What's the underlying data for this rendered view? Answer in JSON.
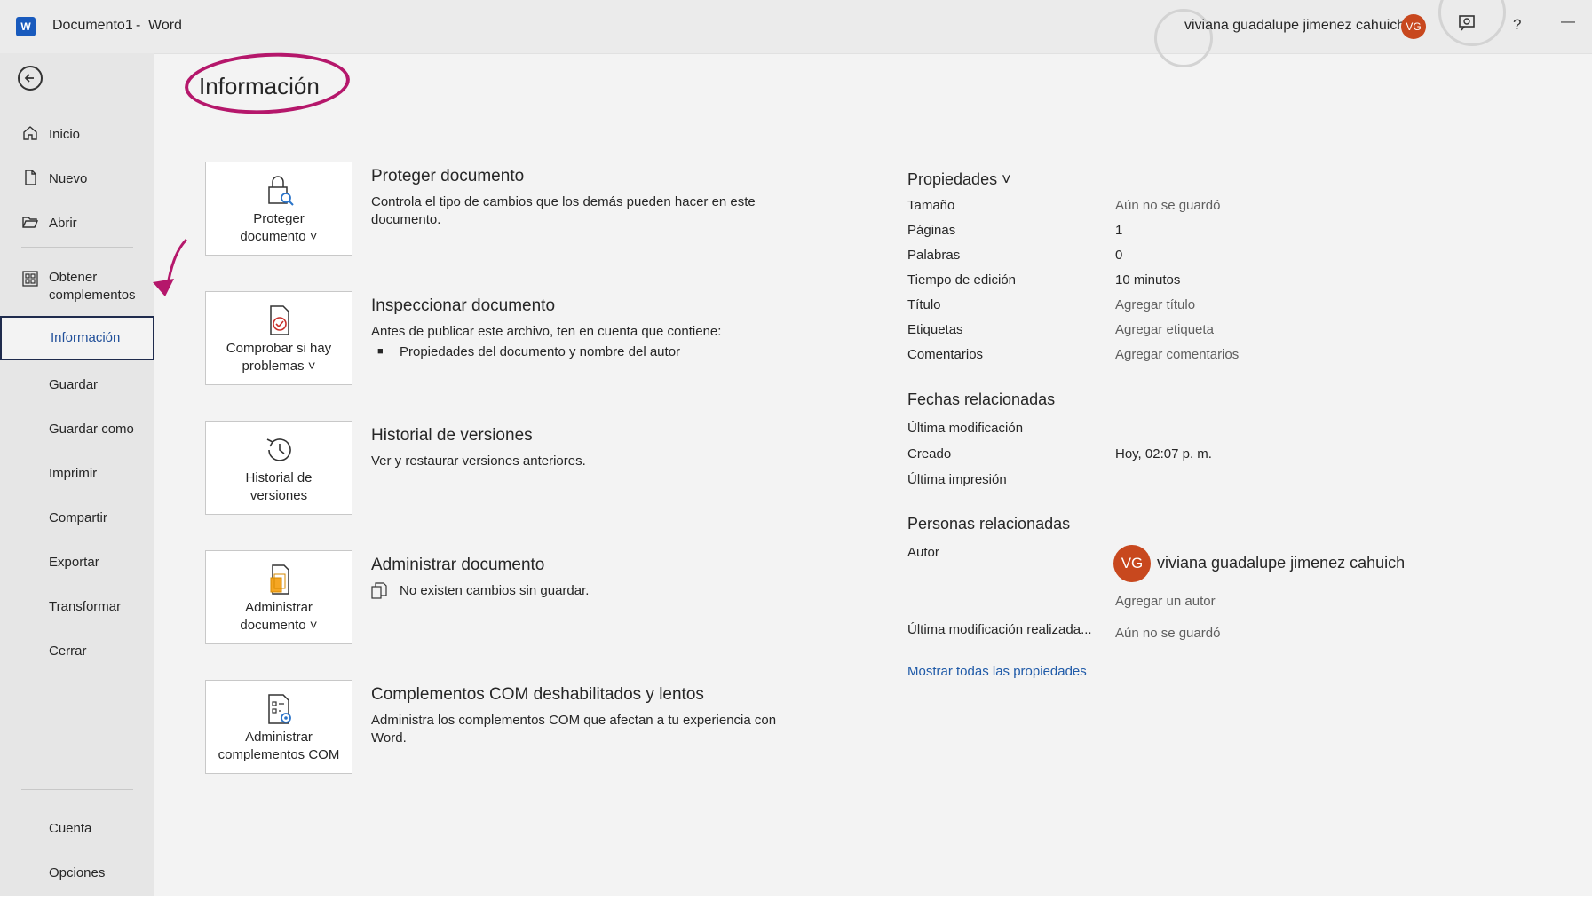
{
  "titlebar": {
    "doc_name": "Documento1",
    "separator": "-",
    "app_name": "Word",
    "user_name": "viviana guadalupe jimenez cahuich",
    "user_initials": "VG",
    "help_label": "?",
    "minimize_label": "—"
  },
  "sidebar": {
    "items": [
      {
        "label": "Inicio",
        "icon": "home-icon"
      },
      {
        "label": "Nuevo",
        "icon": "new-document-icon"
      },
      {
        "label": "Abrir",
        "icon": "folder-open-icon"
      },
      {
        "label": "Obtener complementos",
        "icon": "addins-grid-icon"
      },
      {
        "label": "Información",
        "active": true
      },
      {
        "label": "Guardar"
      },
      {
        "label": "Guardar como"
      },
      {
        "label": "Imprimir"
      },
      {
        "label": "Compartir"
      },
      {
        "label": "Exportar"
      },
      {
        "label": "Transformar"
      },
      {
        "label": "Cerrar"
      },
      {
        "label": "Cuenta"
      },
      {
        "label": "Opciones"
      }
    ]
  },
  "main": {
    "title": "Información",
    "sections": [
      {
        "tile_label_1": "Proteger",
        "tile_label_2": "documento ˅",
        "title": "Proteger documento",
        "desc": "Controla el tipo de cambios que los demás pueden hacer en este documento."
      },
      {
        "tile_label_1": "Comprobar si hay",
        "tile_label_2": "problemas ˅",
        "title": "Inspeccionar documento",
        "desc": "Antes de publicar este archivo, ten en cuenta que contiene:",
        "bullet": "Propiedades del documento y nombre del autor"
      },
      {
        "tile_label_1": "Historial de",
        "tile_label_2": "versiones",
        "title": "Historial de versiones",
        "desc": "Ver y restaurar versiones anteriores."
      },
      {
        "tile_label_1": "Administrar",
        "tile_label_2": "documento ˅",
        "title": "Administrar documento",
        "desc": "No existen cambios sin guardar."
      },
      {
        "tile_label_1": "Administrar",
        "tile_label_2": "complementos COM",
        "title": "Complementos COM deshabilitados y lentos",
        "desc": "Administra los complementos COM que afectan a tu experiencia con Word."
      }
    ]
  },
  "properties": {
    "header": "Propiedades ˅",
    "rows": [
      {
        "label": "Tamaño",
        "value": "Aún no se guardó"
      },
      {
        "label": "Páginas",
        "value": "1"
      },
      {
        "label": "Palabras",
        "value": "0"
      },
      {
        "label": "Tiempo de edición",
        "value": "10 minutos"
      },
      {
        "label": "Título",
        "value": "Agregar título"
      },
      {
        "label": "Etiquetas",
        "value": "Agregar etiqueta"
      },
      {
        "label": "Comentarios",
        "value": "Agregar comentarios"
      }
    ],
    "dates_header": "Fechas relacionadas",
    "dates": [
      {
        "label": "Última modificación",
        "value": ""
      },
      {
        "label": "Creado",
        "value": "Hoy, 02:07 p. m."
      },
      {
        "label": "Última impresión",
        "value": ""
      }
    ],
    "people_header": "Personas relacionadas",
    "author_label": "Autor",
    "author_initials": "VG",
    "author_name": "viviana guadalupe jimenez cahuich",
    "add_author": "Agregar un autor",
    "last_modified_by_label": "Última modificación realizada...",
    "last_modified_by_value": "Aún no se guardó",
    "show_all_link": "Mostrar todas las propiedades"
  },
  "colors": {
    "accent": "#185abd",
    "annotation": "#b5176b",
    "avatar": "#c8481e",
    "link": "#1f5aa8"
  }
}
